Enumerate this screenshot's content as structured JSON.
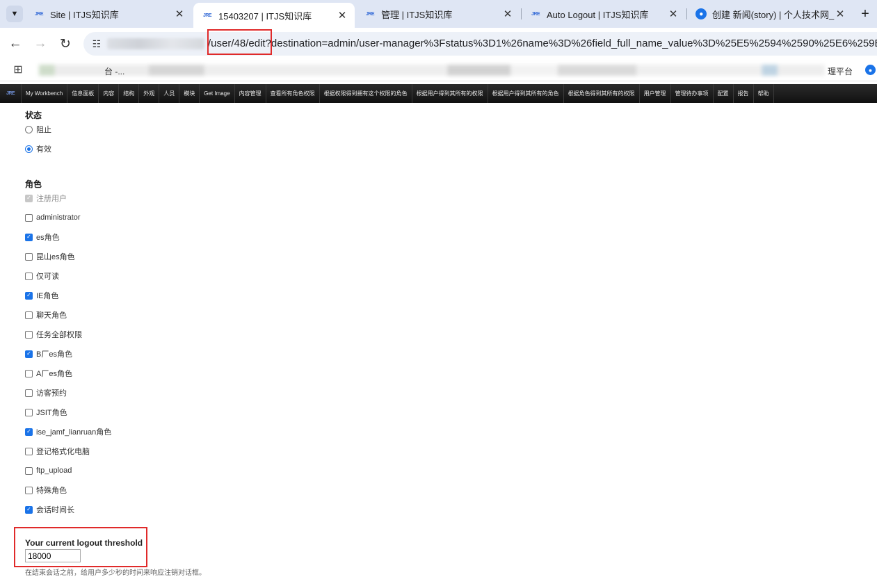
{
  "browser": {
    "tabs": [
      {
        "title": "Site | ITJS知识库",
        "favicon": "itjs-logo-icon",
        "active": false
      },
      {
        "title": "15403207 | ITJS知识库",
        "favicon": "itjs-logo-icon",
        "active": true
      },
      {
        "title": "管理 | ITJS知识库",
        "favicon": "itjs-logo-icon",
        "active": false
      },
      {
        "title": "Auto Logout | ITJS知识库",
        "favicon": "itjs-logo-icon",
        "active": false
      },
      {
        "title": "创建 新闻(story) | 个人技术网_",
        "favicon": "drupal-icon",
        "active": false
      }
    ],
    "url_path": "/user/48/edit?destination=admin/user-manager%3Fstatus%3D1%26name%3D%26field_full_name_value%3D%25E5%2594%2590%25E6%259E%25",
    "bookmarks_visible": [
      "台 -...",
      "理平台"
    ]
  },
  "admin_menu": {
    "items": [
      "My Workbench",
      "信息面板",
      "内容",
      "结构",
      "外观",
      "人员",
      "模块",
      "Get Image",
      "内容管理",
      "查看所有角色权限",
      "根据权限得到拥有这个权限的角色",
      "根据用户得到其所有的权限",
      "根据用户得到其所有的角色",
      "根据角色得到其所有的权限",
      "用户管理",
      "管理待办事项",
      "配置",
      "报告",
      "帮助"
    ]
  },
  "status": {
    "label": "状态",
    "options": [
      {
        "label": "阻止",
        "checked": false
      },
      {
        "label": "有效",
        "checked": true
      }
    ]
  },
  "roles": {
    "label": "角色",
    "options": [
      {
        "label": "注册用户",
        "checked": true,
        "disabled": true
      },
      {
        "label": "administrator",
        "checked": false
      },
      {
        "label": "es角色",
        "checked": true
      },
      {
        "label": "昆山es角色",
        "checked": false
      },
      {
        "label": "仅可读",
        "checked": false
      },
      {
        "label": "IE角色",
        "checked": true
      },
      {
        "label": "聊天角色",
        "checked": false
      },
      {
        "label": "任务全部权限",
        "checked": false
      },
      {
        "label": "B厂es角色",
        "checked": true
      },
      {
        "label": "A厂es角色",
        "checked": false
      },
      {
        "label": "访客预约",
        "checked": false
      },
      {
        "label": "JSIT角色",
        "checked": false
      },
      {
        "label": "ise_jamf_lianruan角色",
        "checked": true
      },
      {
        "label": "登记格式化电脑",
        "checked": false
      },
      {
        "label": "ftp_upload",
        "checked": false
      },
      {
        "label": "特殊角色",
        "checked": false
      },
      {
        "label": "会话时间长",
        "checked": true
      }
    ]
  },
  "logout_threshold": {
    "label": "Your current logout threshold",
    "value": "18000",
    "description": "在结束会话之前，给用户多少秒的时间来响应注销对话框。"
  },
  "colors": {
    "accent": "#1a73e8",
    "highlight_box": "#e02a2a",
    "admin_bar": "#1a1a1a"
  }
}
